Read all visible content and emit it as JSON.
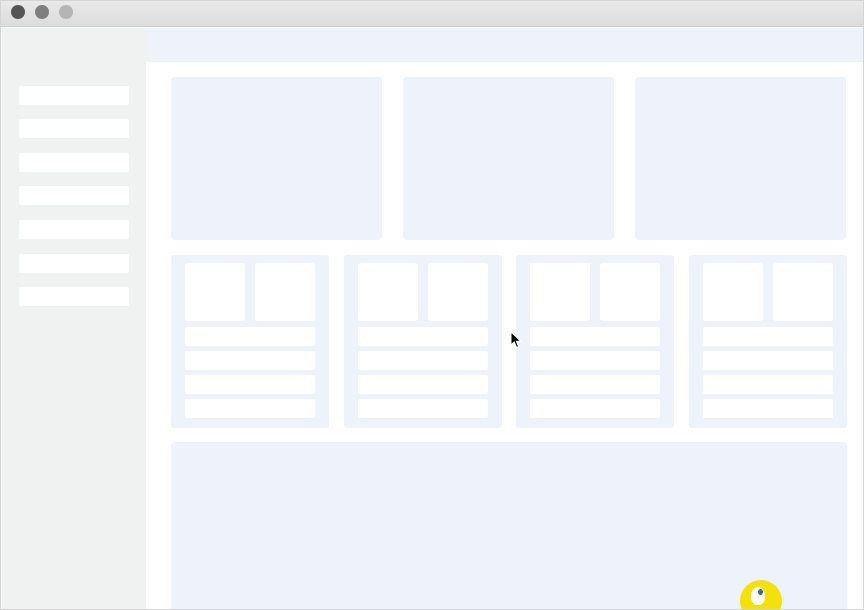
{
  "window": {
    "title": "",
    "controls": [
      "close",
      "minimize",
      "zoom"
    ]
  },
  "sidebar": {
    "items": [
      {
        "label": ""
      },
      {
        "label": ""
      },
      {
        "label": ""
      },
      {
        "label": ""
      },
      {
        "label": ""
      },
      {
        "label": ""
      },
      {
        "label": ""
      }
    ]
  },
  "topbar": {
    "title": ""
  },
  "main": {
    "feature_cards": [
      {
        "label": ""
      },
      {
        "label": ""
      },
      {
        "label": ""
      }
    ],
    "small_cards": [
      {
        "lines": [
          "",
          "",
          "",
          ""
        ]
      },
      {
        "lines": [
          "",
          "",
          "",
          ""
        ]
      },
      {
        "lines": [
          "",
          "",
          "",
          ""
        ]
      },
      {
        "lines": [
          "",
          "",
          "",
          ""
        ]
      }
    ],
    "panel": {
      "label": ""
    }
  },
  "colors": {
    "sidebar_bg": "#f0f1f1",
    "card_bg": "#eef2fa",
    "placeholder": "#ffffff",
    "click_indicator": "#f5e10a",
    "traffic_close": "#555555",
    "traffic_minimize": "#7f7f7f",
    "traffic_zoom": "#b5b5b5"
  },
  "icons": {
    "cursor": "mouse-cursor-icon",
    "click": "click-indicator-icon"
  }
}
